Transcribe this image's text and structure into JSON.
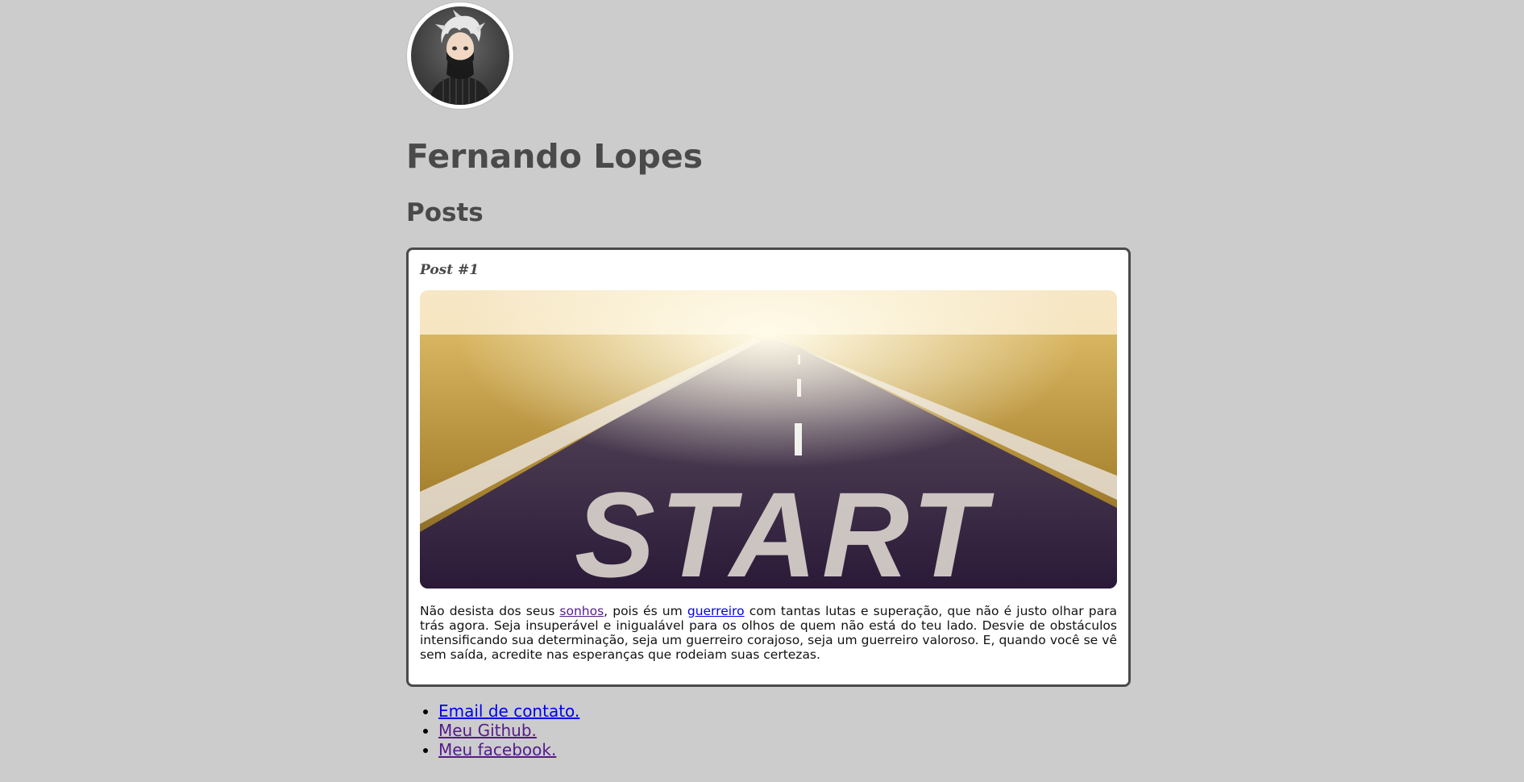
{
  "profile": {
    "name": "Fernando Lopes",
    "avatar_icon": "anime-avatar-icon"
  },
  "posts_heading": "Posts",
  "post": {
    "title": "Post #1",
    "image_text": "START",
    "text_before_link1": "Não desista dos seus ",
    "link1": "sonhos",
    "text_between": ", pois és um ",
    "link2": "guerreiro",
    "text_after": " com tantas lutas e superação, que não é justo olhar para trás agora. Seja insuperável e inigualável para os olhos de quem não está do teu lado. Desvie de obstáculos intensificando sua determinação, seja um guerreiro corajoso, seja um guerreiro valoroso. E, quando você se vê sem saída, acredite nas esperanças que rodeiam suas certezas."
  },
  "links": [
    {
      "label": "Email de contato."
    },
    {
      "label": "Meu Github."
    },
    {
      "label": "Meu facebook."
    }
  ],
  "colors": {
    "background": "#cccccc",
    "heading": "#4a4a4a",
    "link": "#0000ee",
    "visited_link": "#551a8b"
  }
}
